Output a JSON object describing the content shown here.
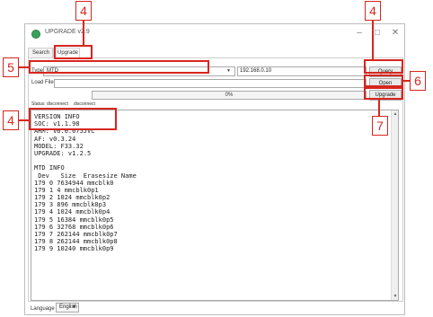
{
  "window": {
    "title": "UPGRADE v2.9",
    "minimize": "–",
    "maximize": "□",
    "close": "✕"
  },
  "tabs": [
    {
      "label": "Search"
    },
    {
      "label": "Upgrade"
    }
  ],
  "form": {
    "type_label": "Type",
    "type_value": "MTD",
    "ip_value": "192.168.0.10",
    "query_label": "Query",
    "load_file_label": "Load File",
    "load_file_value": "",
    "open_label": "Open",
    "progress_value": "0%",
    "progress_fraction": 0,
    "upgrade_label": "Upgrade",
    "status_label": "Status:",
    "status_value": "disconnect",
    "status_value2": "disconnect"
  },
  "log": {
    "lines": [
      "VERSION INFO",
      "SOC: v1.1.98",
      "ARM: v6.0.675JVC",
      "AF: v0.3.24",
      "MODEL: F33.32",
      "UPGRADE: v1.2.5",
      "",
      "MTD INFO",
      " Dev   Size  Erasesize Name",
      "179 0 7634944 mmcblk0",
      "179 1 4 mmcblk0p1",
      "179 2 1024 mmcblk0p2",
      "179 3 896 mmcblk0p3",
      "179 4 1024 mmcblk0p4",
      "179 5 16384 mmcblk0p5",
      "179 6 32768 mmcblk0p6",
      "179 7 262144 mmcblk0p7",
      "179 8 262144 mmcblk0p8",
      "179 9 10240 mmcblk0p9"
    ]
  },
  "language": {
    "label": "Language",
    "value": "English"
  },
  "callouts": {
    "c1": "4",
    "c2": "4",
    "c3": "5",
    "c4": "6",
    "c5": "4",
    "c6": "7"
  },
  "colors": {
    "annotation": "#d7261e",
    "app_icon": "#3aa35a"
  }
}
